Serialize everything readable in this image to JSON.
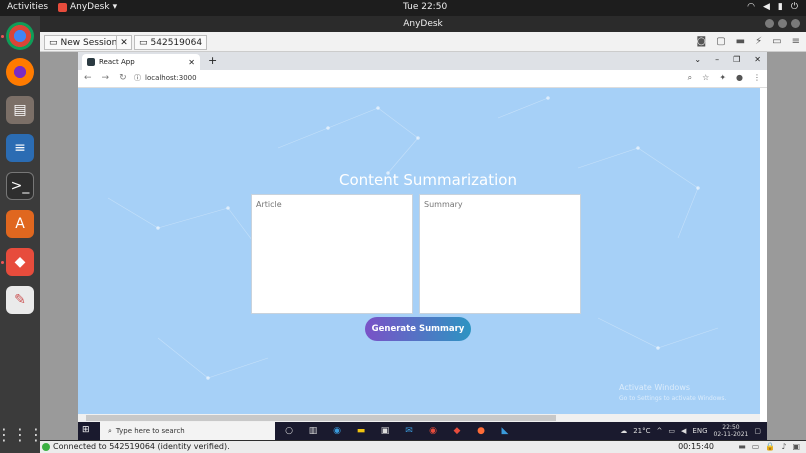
{
  "topbar": {
    "activities": "Activities",
    "app_menu": "AnyDesk",
    "clock": "Tue 22:50",
    "tray_icons": [
      "wifi-icon",
      "volume-icon",
      "battery-icon",
      "power-icon"
    ]
  },
  "dock": {
    "apps": [
      "chrome-icon",
      "firefox-icon",
      "files-icon",
      "writer-icon",
      "terminal-icon",
      "software-icon",
      "anydesk-icon",
      "text-editor-icon"
    ],
    "show_apps_icon": "grid-icon"
  },
  "anydesk": {
    "window_title": "AnyDesk",
    "new_session_label": "New Session",
    "session_id": "542519064",
    "status_text": "Connected to 542519064 (identity verified).",
    "timer": "00:15:40"
  },
  "browser": {
    "tab_title": "React App",
    "new_tab": "+",
    "url": "localhost:3000"
  },
  "page": {
    "title": "Content Summarization",
    "article_placeholder": "Article",
    "summary_placeholder": "Summary",
    "button_label": "Generate Summary",
    "watermark_title": "Activate Windows",
    "watermark_sub": "Go to Settings to activate Windows."
  },
  "taskbar": {
    "search_placeholder": "Type here to search",
    "weather": "21°C",
    "lang": "ENG",
    "time": "22:50",
    "date": "02-11-2021"
  },
  "colors": {
    "page_bg": "#a6d0f7",
    "button_gradient_start": "#7a52c7",
    "button_gradient_end": "#2d94c2"
  }
}
